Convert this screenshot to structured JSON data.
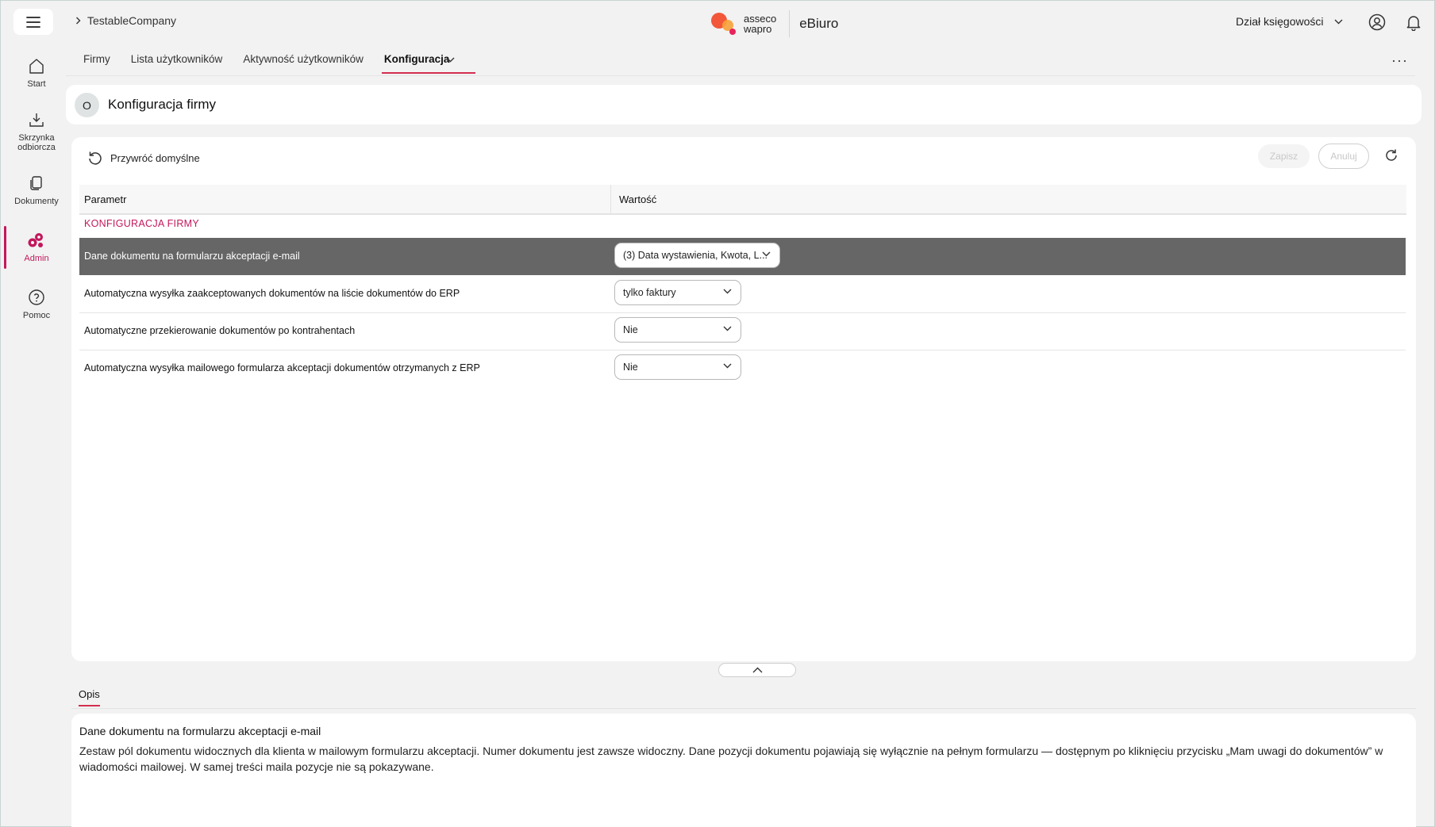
{
  "header": {
    "breadcrumb": "TestableCompany",
    "brand_line1": "asseco",
    "brand_line2": "wapro",
    "app_name": "eBiuro",
    "department": "Dział księgowości"
  },
  "sidebar": {
    "items": [
      {
        "label": "Start",
        "icon": "home-icon"
      },
      {
        "label": "Skrzynka odbiorcza",
        "icon": "inbox-download-icon"
      },
      {
        "label": "Dokumenty",
        "icon": "documents-icon"
      },
      {
        "label": "Admin",
        "icon": "admin-gears-icon",
        "active": true
      },
      {
        "label": "Pomoc",
        "icon": "help-icon"
      }
    ]
  },
  "tabs": [
    {
      "label": "Firmy"
    },
    {
      "label": "Lista użytkowników"
    },
    {
      "label": "Aktywność użytkowników"
    },
    {
      "label": "Konfiguracja",
      "active": true
    }
  ],
  "page": {
    "avatar_letter": "O",
    "title": "Konfiguracja firmy"
  },
  "toolbar": {
    "restore_label": "Przywróć domyślne",
    "save_label": "Zapisz",
    "cancel_label": "Anuluj"
  },
  "table": {
    "headers": {
      "param": "Parametr",
      "value": "Wartość"
    },
    "section": "KONFIGURACJA FIRMY",
    "rows": [
      {
        "label": "Dane dokumentu na formularzu akceptacji e-mail",
        "value": "(3) Data wystawienia, Kwota, L...",
        "selected": true
      },
      {
        "label": "Automatyczna wysyłka zaakceptowanych dokumentów na liście dokumentów do ERP",
        "value": "tylko faktury"
      },
      {
        "label": "Automatyczne przekierowanie dokumentów po kontrahentach",
        "value": "Nie"
      },
      {
        "label": "Automatyczna wysyłka mailowego formularza akceptacji dokumentów otrzymanych z ERP",
        "value": "Nie"
      }
    ]
  },
  "description": {
    "tab_label": "Opis",
    "title": "Dane dokumentu na formularzu akceptacji e-mail",
    "body": "Zestaw pól dokumentu widocznych dla klienta w mailowym formularzu akceptacji. Numer dokumentu jest zawsze widoczny. Dane pozycji dokumentu pojawiają się wyłącznie na pełnym formularzu — dostępnym po kliknięciu przycisku „Mam uwagi do dokumentów” w wiadomości mailowej. W samej treści maila pozycje nie są pokazywane."
  },
  "colors": {
    "accent": "#c2185b",
    "tab_underline": "#d32f4f",
    "selected_row": "#666666",
    "background": "#f2f2f2"
  }
}
